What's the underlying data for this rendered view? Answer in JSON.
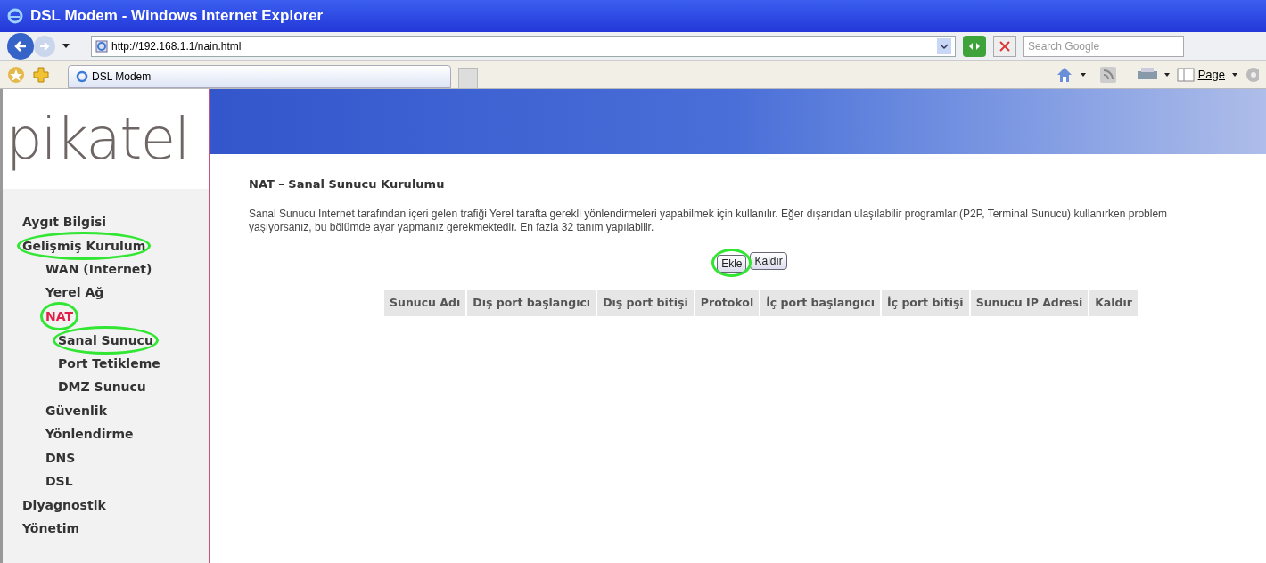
{
  "window": {
    "title": "DSL Modem - Windows Internet Explorer"
  },
  "address_bar": {
    "url": "http://192.168.1.1/nain.html"
  },
  "search": {
    "placeholder": "Search Google"
  },
  "tabs": [
    {
      "label": "DSL Modem",
      "selected": true
    }
  ],
  "toolbar": {
    "page_menu": "Page"
  },
  "logo": "pikatel",
  "sidebar": {
    "items": [
      {
        "label": "Aygıt Bilgisi",
        "selected": false,
        "circled": false
      },
      {
        "label": "Gelişmiş Kurulum",
        "selected": false,
        "circled": true,
        "children": [
          {
            "label": "WAN (Internet)",
            "selected": false,
            "circled": false
          },
          {
            "label": "Yerel Ağ",
            "selected": false,
            "circled": false
          },
          {
            "label": "NAT",
            "selected": true,
            "circled": true,
            "children": [
              {
                "label": "Sanal Sunucu",
                "selected": false,
                "circled": true
              },
              {
                "label": "Port Tetikleme",
                "selected": false,
                "circled": false
              },
              {
                "label": "DMZ Sunucu",
                "selected": false,
                "circled": false
              }
            ]
          },
          {
            "label": "Güvenlik",
            "selected": false,
            "circled": false
          },
          {
            "label": "Yönlendirme",
            "selected": false,
            "circled": false
          },
          {
            "label": "DNS",
            "selected": false,
            "circled": false
          },
          {
            "label": "DSL",
            "selected": false,
            "circled": false
          }
        ]
      },
      {
        "label": "Diyagnostik",
        "selected": false,
        "circled": false
      },
      {
        "label": "Yönetim",
        "selected": false,
        "circled": false
      }
    ]
  },
  "content": {
    "heading": "NAT – Sanal Sunucu Kurulumu",
    "description": "Sanal Sunucu Internet tarafından içeri gelen trafiği Yerel tarafta gerekli yönlendirmeleri yapabilmek için kullanılır. Eğer dışarıdan ulaşılabilir programları(P2P, Terminal Sunucu) kullanırken problem yaşıyorsanız, bu bölümde ayar yapmanız gerekmektedir. En fazla 32 tanım yapılabilir.",
    "buttons": [
      {
        "label": "Ekle",
        "circled": true
      },
      {
        "label": "Kaldır",
        "circled": false
      }
    ],
    "table": {
      "columns": [
        "Sunucu Adı",
        "Dış port başlangıcı",
        "Dış port bitişi",
        "Protokol",
        "İç port başlangıcı",
        "İç port bitişi",
        "Sunucu IP Adresi",
        "Kaldır"
      ]
    }
  }
}
